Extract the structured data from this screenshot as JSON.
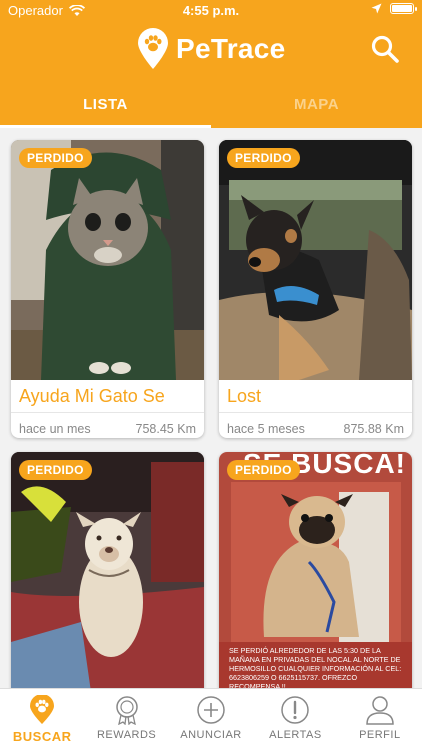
{
  "status_bar": {
    "carrier": "Operador",
    "time": "4:55 p.m."
  },
  "app": {
    "name": "PeTrace"
  },
  "tabs": [
    {
      "label": "LISTA",
      "active": true
    },
    {
      "label": "MAPA",
      "active": false
    }
  ],
  "cards": [
    {
      "badge": "PERDIDO",
      "title": "Ayuda Mi Gato Se",
      "time_ago": "hace un mes",
      "distance": "758.45 Km"
    },
    {
      "badge": "PERDIDO",
      "title": "Lost",
      "time_ago": "hace 5 meses",
      "distance": "875.88 Km"
    },
    {
      "badge": "PERDIDO",
      "title": "",
      "time_ago": "",
      "distance": ""
    },
    {
      "badge": "PERDIDO",
      "title": "",
      "time_ago": "",
      "distance": "",
      "poster_heading": "SE BUSCA!",
      "poster_text": "SE PERDIÓ ALREDEDOR DE LAS 5:30 DE LA MAÑANA EN PRIVADAS DEL NOCAL AL NORTE DE HERMOSILLO CUALQUIER INFORMACIÓN AL CEL: 6623806259 O 6625115737. OFREZCO RECOMPENSA !!"
    }
  ],
  "bottom_nav": [
    {
      "label": "BUSCAR",
      "icon": "paw-icon",
      "active": true
    },
    {
      "label": "REWARDS",
      "icon": "medal-icon",
      "active": false
    },
    {
      "label": "ANUNCIAR",
      "icon": "plus-circle-icon",
      "active": false
    },
    {
      "label": "ALERTAS",
      "icon": "alert-circle-icon",
      "active": false
    },
    {
      "label": "PERFIL",
      "icon": "user-icon",
      "active": false
    }
  ],
  "colors": {
    "accent": "#f7a51d",
    "inactive_tab": "#fbd28b",
    "card_meta": "#888888"
  }
}
